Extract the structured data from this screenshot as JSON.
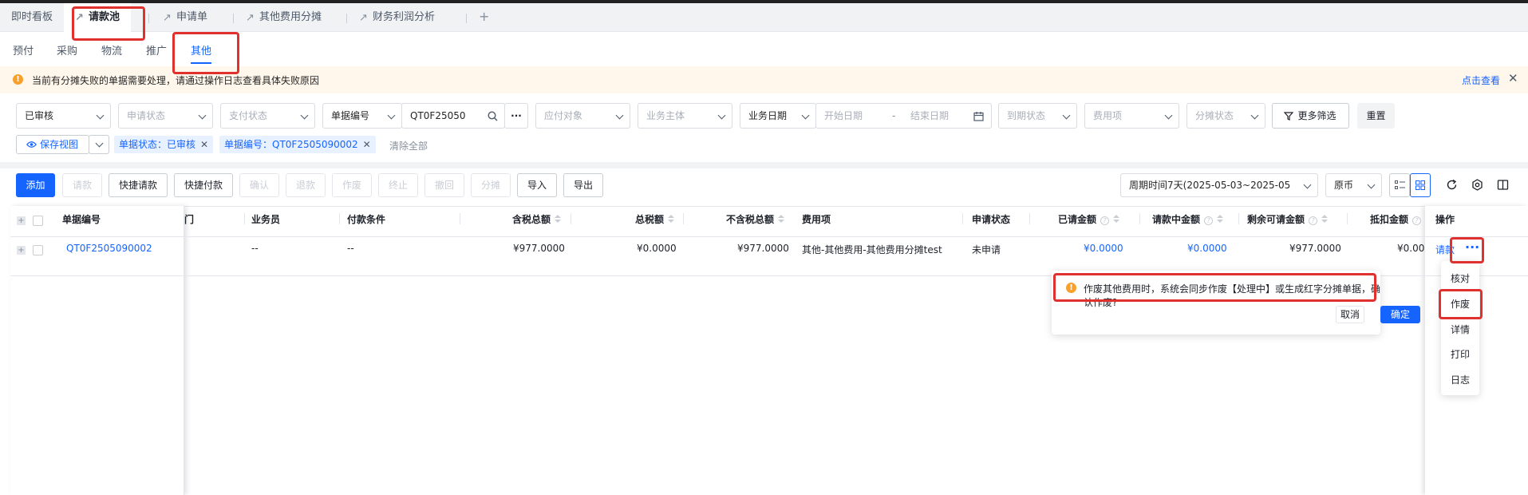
{
  "tabs": [
    {
      "label": "即时看板",
      "pinned": false
    },
    {
      "label": "请款池",
      "pinned": true
    },
    {
      "label": "申请单",
      "pinned": true
    },
    {
      "label": "其他费用分摊",
      "pinned": true
    },
    {
      "label": "财务利润分析",
      "pinned": true
    }
  ],
  "sub_tabs": [
    "预付",
    "采购",
    "物流",
    "推广",
    "其他"
  ],
  "alert": {
    "text": "当前有分摊失败的单据需要处理，请通过操作日志查看具体失败原因",
    "link": "点击查看"
  },
  "filters": {
    "status": "已审核",
    "apply_status": "申请状态",
    "pay_status": "支付状态",
    "doc_no_type": "单据编号",
    "doc_no_value": "QT0F25050",
    "target": "应付对象",
    "entity": "业务主体",
    "date_type": "业务日期",
    "start_date": "开始日期",
    "date_sep": "-",
    "end_date": "结束日期",
    "due_status": "到期状态",
    "fee_item": "费用项",
    "split_status": "分摊状态",
    "more_filter": "更多筛选",
    "reset": "重置"
  },
  "view": {
    "save_view": "保存视图",
    "chips": [
      "单据状态：已审核",
      "单据编号：QT0F2505090002"
    ],
    "clear_all": "清除全部"
  },
  "toolbar": {
    "buttons": [
      "添加",
      "请款",
      "快捷请款",
      "快捷付款",
      "确认",
      "退款",
      "作废",
      "终止",
      "撤回",
      "分摊",
      "导入",
      "导出"
    ],
    "period": "周期时间7天(2025-05-03~2025-05",
    "currency": "原币"
  },
  "table": {
    "headers": {
      "doc_no": "单据编号",
      "dept": "门",
      "salesman": "业务员",
      "pay_terms": "付款条件",
      "tax_total": "含税总额",
      "tax": "总税额",
      "net_total": "不含税总额",
      "fee_item": "费用项",
      "apply_status": "申请状态",
      "requested": "已请金额",
      "requesting": "请款中金额",
      "remaining": "剩余可请金额",
      "deduct": "抵扣金额",
      "ops": "操作"
    },
    "row": {
      "doc_no": "QT0F2505090002",
      "salesman": "--",
      "pay_terms": "--",
      "tax_total": "¥977.0000",
      "tax": "¥0.0000",
      "net_total": "¥977.0000",
      "fee_item": "其他-其他费用-其他费用分摊test",
      "apply_status": "未申请",
      "requested": "¥0.0000",
      "requesting": "¥0.0000",
      "remaining": "¥977.0000",
      "deduct": "¥0.00",
      "op_link": "请款"
    }
  },
  "popconfirm": {
    "text": "作废其他费用时，系统会同步作废【处理中】或生成红字分摊单据，确认作废?",
    "cancel": "取消",
    "ok": "确定"
  },
  "more_menu": [
    "核对",
    "作废",
    "详情",
    "打印",
    "日志"
  ],
  "colors": {
    "primary": "#1664ff",
    "warning": "#f7a02c",
    "highlight": "#e0312f"
  }
}
